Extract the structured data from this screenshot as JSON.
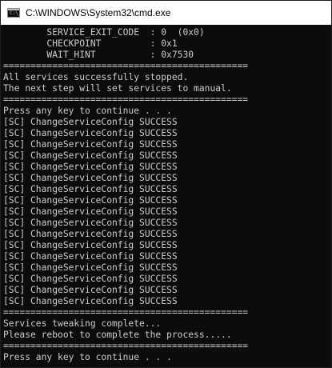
{
  "window": {
    "title": "C:\\WINDOWS\\System32\\cmd.exe",
    "icon": "cmd-icon",
    "icon_prompt": "C:\\_"
  },
  "console": {
    "background": "#0c0c0c",
    "foreground": "#cccccc",
    "lines": [
      "        SERVICE_EXIT_CODE  : 0  (0x0)",
      "        CHECKPOINT         : 0x1",
      "        WAIT_HINT          : 0x7530",
      "=============================================",
      "All services successfully stopped.",
      "The next step will set services to manual.",
      "=============================================",
      "Press any key to continue . . .",
      "[SC] ChangeServiceConfig SUCCESS",
      "[SC] ChangeServiceConfig SUCCESS",
      "[SC] ChangeServiceConfig SUCCESS",
      "[SC] ChangeServiceConfig SUCCESS",
      "[SC] ChangeServiceConfig SUCCESS",
      "[SC] ChangeServiceConfig SUCCESS",
      "[SC] ChangeServiceConfig SUCCESS",
      "[SC] ChangeServiceConfig SUCCESS",
      "[SC] ChangeServiceConfig SUCCESS",
      "[SC] ChangeServiceConfig SUCCESS",
      "[SC] ChangeServiceConfig SUCCESS",
      "[SC] ChangeServiceConfig SUCCESS",
      "[SC] ChangeServiceConfig SUCCESS",
      "[SC] ChangeServiceConfig SUCCESS",
      "[SC] ChangeServiceConfig SUCCESS",
      "[SC] ChangeServiceConfig SUCCESS",
      "[SC] ChangeServiceConfig SUCCESS",
      "=============================================",
      "Services tweaking complete...",
      "Please reboot to complete the process.....",
      "=============================================",
      "Press any key to continue . . ."
    ]
  }
}
